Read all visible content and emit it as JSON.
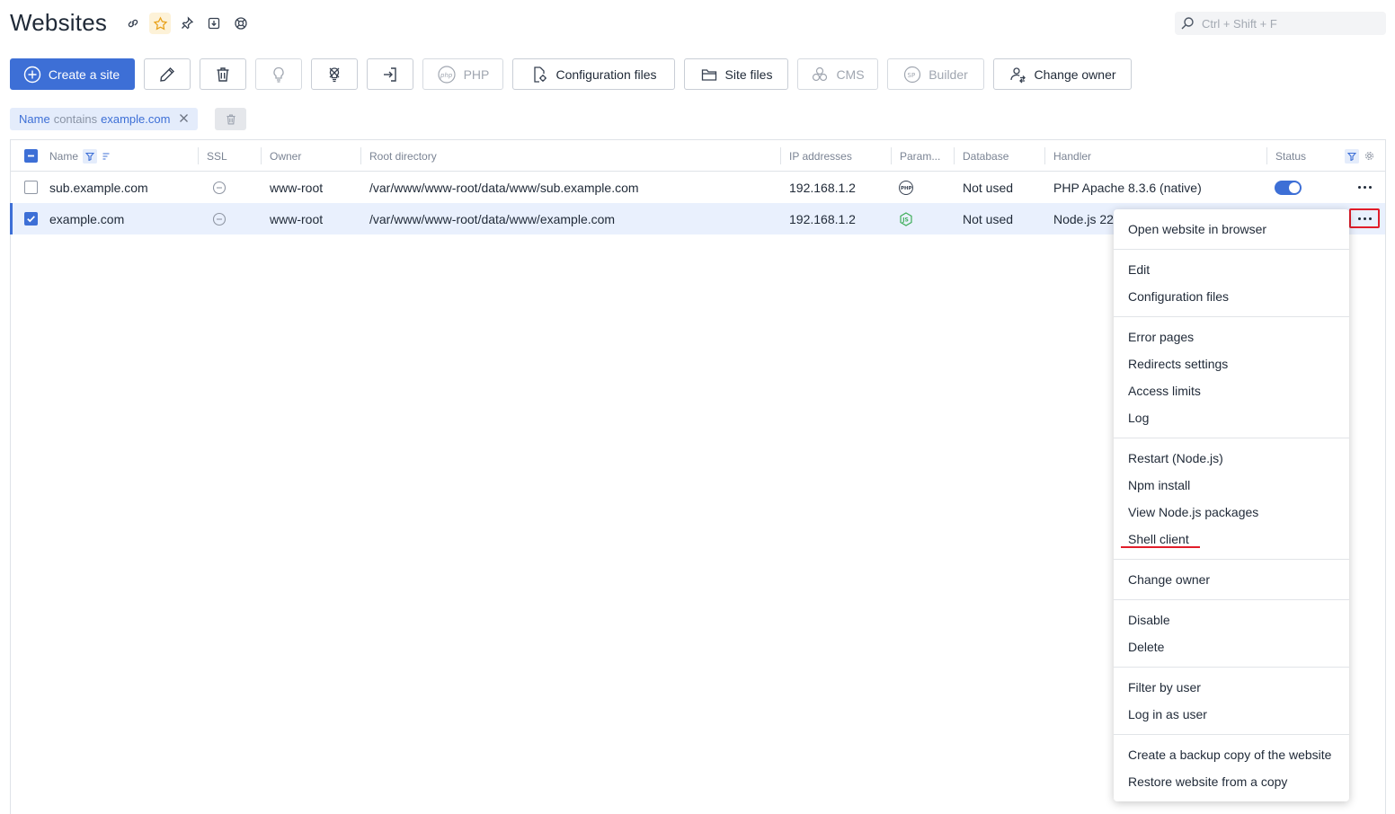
{
  "header": {
    "title": "Websites"
  },
  "search": {
    "placeholder": "Ctrl + Shift + F"
  },
  "toolbar": {
    "create_label": "Create a site",
    "php_label": "PHP",
    "config_label": "Configuration files",
    "site_files_label": "Site files",
    "cms_label": "CMS",
    "builder_label": "Builder",
    "change_owner_label": "Change owner"
  },
  "filter": {
    "field": "Name",
    "operator": "contains",
    "value": "example.com"
  },
  "table": {
    "columns": [
      "Name",
      "SSL",
      "Owner",
      "Root directory",
      "IP addresses",
      "Param...",
      "Database",
      "Handler",
      "Status"
    ],
    "rows": [
      {
        "name": "sub.example.com",
        "owner": "www-root",
        "root": "/var/www/www-root/data/www/sub.example.com",
        "ip": "192.168.1.2",
        "database": "Not used",
        "handler": "PHP Apache 8.3.6 (native)",
        "selected": false
      },
      {
        "name": "example.com",
        "owner": "www-root",
        "root": "/var/www/www-root/data/www/example.com",
        "ip": "192.168.1.2",
        "database": "Not used",
        "handler": "Node.js 22",
        "selected": true
      }
    ]
  },
  "menu": {
    "items": [
      "Open website in browser",
      "Edit",
      "Configuration files",
      "Error pages",
      "Redirects settings",
      "Access limits",
      "Log",
      "Restart (Node.js)",
      "Npm install",
      "View Node.js packages",
      "Shell client",
      "Change owner",
      "Disable",
      "Delete",
      "Filter by user",
      "Log in as user",
      "Create a backup copy of the website",
      "Restore website from a copy"
    ]
  },
  "colors": {
    "accent": "#3d6fd6",
    "highlight": "#e11d2a",
    "node_green": "#3fae5a"
  }
}
